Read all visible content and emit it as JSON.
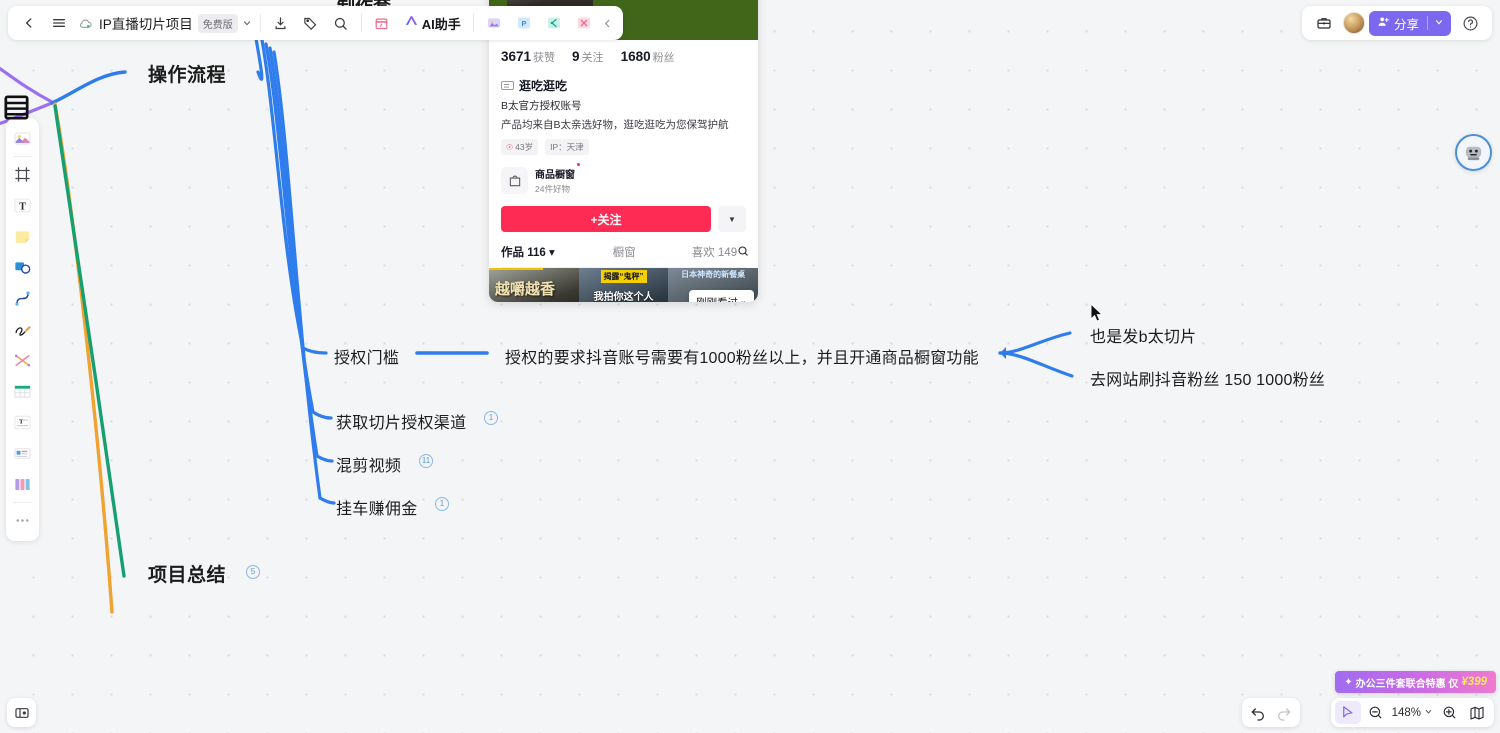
{
  "topbar": {
    "back_icon": "chevron-left-icon",
    "menu_icon": "hamburger-menu-icon",
    "cloud_icon": "cloud-sync-icon",
    "doc_title": "IP直播切片项目",
    "plan_badge": "免费版",
    "title_caret": "chevron-down-icon",
    "export_icon": "download-icon",
    "tag_icon": "tag-icon",
    "search_icon": "search-icon",
    "calendar_icon": "calendar-icon",
    "ai_icon": "ai-sparkle-icon",
    "ai_label": "AI助手",
    "image_icon": "image-icon",
    "ppt_icon": "ppt-icon",
    "mindmap_icon": "mindmap-icon",
    "grid_icon": "grid-icon",
    "collapse_icon": "chevron-left-icon"
  },
  "topbar_right": {
    "briefcase_icon": "briefcase-icon",
    "avatar": "user-avatar",
    "share_icon": "share-user-icon",
    "share_label": "分享",
    "share_caret": "chevron-down-icon",
    "help_icon": "help-circle-icon"
  },
  "left_tools": [
    {
      "name": "image-tool",
      "icon": "picture-icon"
    },
    {
      "name": "frame-tool",
      "icon": "frame-icon"
    },
    {
      "name": "text-tool",
      "icon": "text-t-icon"
    },
    {
      "name": "sticky-note-tool",
      "icon": "sticky-note-icon"
    },
    {
      "name": "shape-tool",
      "icon": "shapes-icon"
    },
    {
      "name": "curve-line-tool",
      "icon": "curve-line-icon"
    },
    {
      "name": "pen-tool",
      "icon": "pen-scribble-icon"
    },
    {
      "name": "connector-tool",
      "icon": "connector-icon"
    },
    {
      "name": "table-tool",
      "icon": "table-icon"
    },
    {
      "name": "text-block-tool",
      "icon": "text-block-icon"
    },
    {
      "name": "card-tool",
      "icon": "card-icon"
    },
    {
      "name": "kanban-tool",
      "icon": "kanban-icon"
    },
    {
      "name": "more-tools",
      "icon": "more-dots-icon"
    }
  ],
  "mindmap": {
    "ghost_top_label": "制作套",
    "nodes": [
      {
        "id": "flow",
        "label": "操作流程",
        "level": 1
      },
      {
        "id": "summary",
        "label": "项目总结",
        "level": 1,
        "count": "5"
      },
      {
        "id": "threshold",
        "label": "授权门槛",
        "level": 2
      },
      {
        "id": "threshold_body",
        "label": "授权的要求抖音账号需要有1000粉丝以上，并且开通商品橱窗功能",
        "level": "body"
      },
      {
        "id": "channel",
        "label": "获取切片授权渠道",
        "level": 2,
        "count": "1"
      },
      {
        "id": "mixcut",
        "label": "混剪视频",
        "level": 2,
        "count": "11"
      },
      {
        "id": "commission",
        "label": "挂车赚佣金",
        "level": 2,
        "count": "1"
      },
      {
        "id": "right1",
        "label": "也是发b太切片",
        "level": "body"
      },
      {
        "id": "right2",
        "label": "去网站刷抖音粉丝   150      1000粉丝",
        "level": "body"
      }
    ],
    "colors": {
      "branch_blue": "#2f7ded",
      "branch_orange": "#f0a330",
      "branch_green": "#16a070",
      "branch_purple": "#9b6ff0"
    }
  },
  "douyin_card": {
    "stats": [
      {
        "value": "3671",
        "label": "获赞"
      },
      {
        "value": "9",
        "label": "关注"
      },
      {
        "value": "1680",
        "label": "粉丝"
      }
    ],
    "nickname": "逛吃逛吃",
    "desc_line1": "B太官方授权账号",
    "desc_line2": "产品均来自B太亲选好物，逛吃逛吃为您保驾护航",
    "tags": [
      "43岁",
      "IP：天津"
    ],
    "shop_title": "商品橱窗",
    "shop_sub": "24件好物",
    "follow_label": "+关注",
    "follow_more_icon": "chevron-down-icon",
    "tabs": [
      {
        "label": "作品 116",
        "active": true,
        "caret": "caret-down-icon"
      },
      {
        "label": "橱窗",
        "active": false
      },
      {
        "label": "喜欢 149",
        "active": false
      }
    ],
    "tab_search_icon": "search-icon",
    "thumbs": [
      {
        "big_text": "越嚼越香"
      },
      {
        "yellow_tag": "揭露“鬼秤”",
        "caption": "我拍你这个人"
      },
      {
        "blue_text": "日本神奇的新餐桌"
      }
    ],
    "recent_pill": "刚刚看过",
    "recent_pill_icon": "chevrons-down-icon"
  },
  "robot": {
    "icon": "ai-robot-icon"
  },
  "bottom": {
    "settings_icon": "panel-settings-icon",
    "undo_icon": "undo-arrow-icon",
    "redo_icon": "redo-arrow-icon",
    "pointer_icon": "cursor-pointer-icon",
    "zoom_out_icon": "zoom-out-icon",
    "zoom_level": "148%",
    "zoom_caret": "chevron-down-icon",
    "zoom_in_icon": "zoom-in-icon",
    "minimap_icon": "minimap-icon"
  },
  "promo": {
    "text": "办公三件套联合特惠 仅",
    "price": "¥399",
    "spark_icon": "sparkle-icon"
  },
  "cursor": {
    "icon": "mouse-cursor-icon"
  }
}
